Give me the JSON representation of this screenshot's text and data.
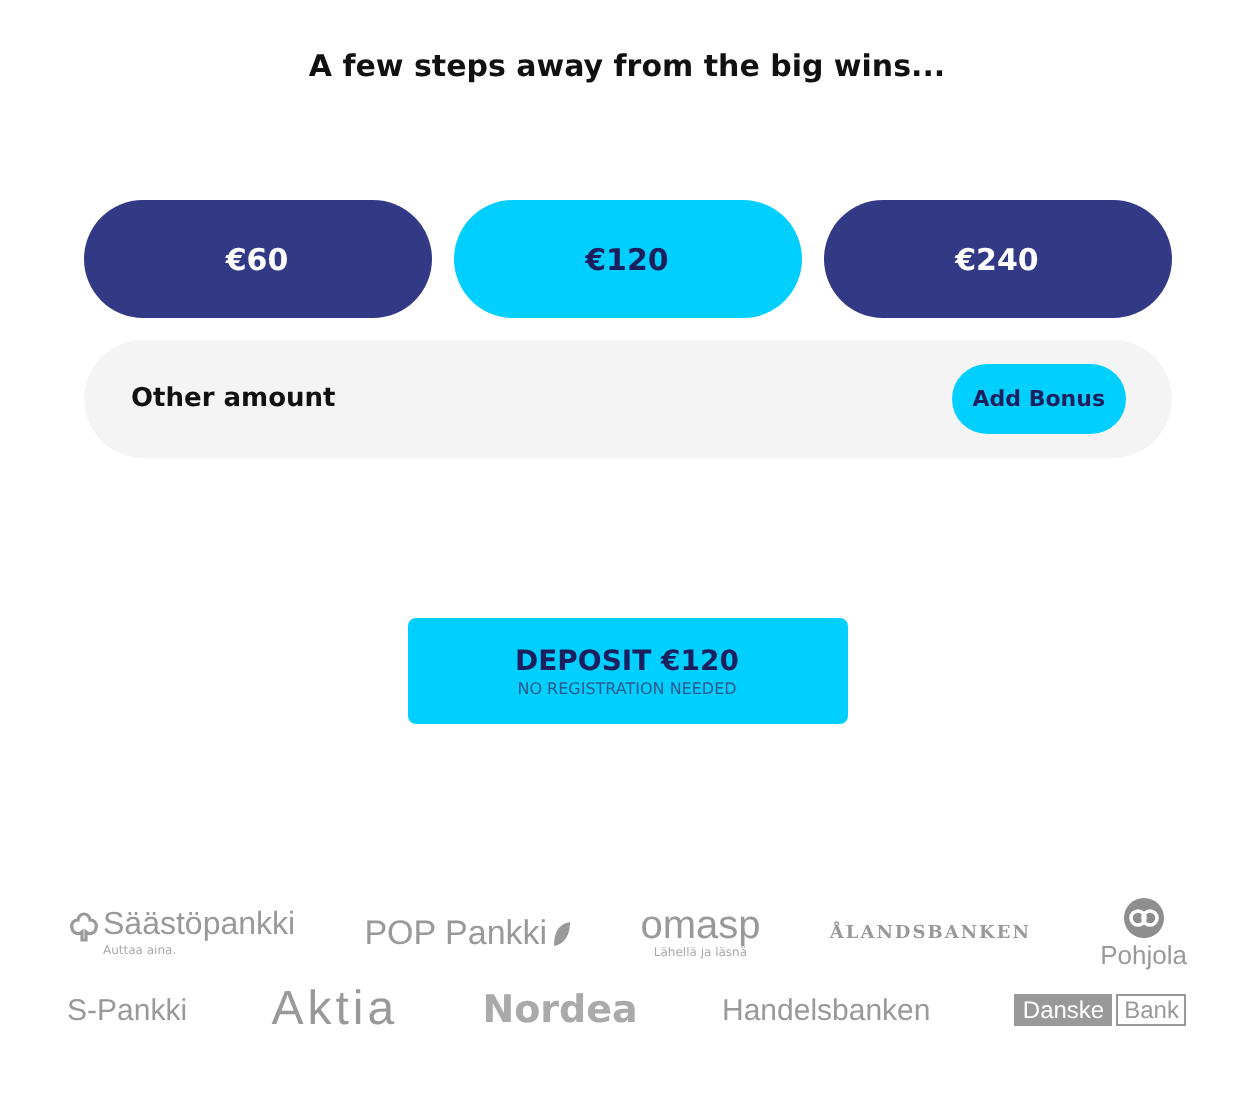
{
  "heading": "A few steps away from the big wins...",
  "amounts": [
    {
      "label": "€60",
      "selected": false
    },
    {
      "label": "€120",
      "selected": true
    },
    {
      "label": "€240",
      "selected": false
    }
  ],
  "other_amount": {
    "label": "Other amount",
    "button": "Add Bonus"
  },
  "deposit": {
    "label": "DEPOSIT €120",
    "sublabel": "NO REGISTRATION NEEDED"
  },
  "banks": [
    [
      {
        "kind": "tree",
        "name": "Säästöpankki",
        "tagline": "Auttaa aina."
      },
      {
        "kind": "leaf",
        "name": "POP Pankki"
      },
      {
        "kind": "loop",
        "name": "omasp",
        "tagline": "Lähellä ja läsnä"
      },
      {
        "kind": "caps",
        "name": "ÅLANDSBANKEN"
      },
      {
        "kind": "circle",
        "name": "Pohjola"
      }
    ],
    [
      {
        "kind": "plain",
        "name": "S-Pankki"
      },
      {
        "kind": "large",
        "name": "Aktia"
      },
      {
        "kind": "round",
        "name": "Nordea"
      },
      {
        "kind": "plain",
        "name": "Handelsbanken"
      },
      {
        "kind": "boxed",
        "name": "Danske",
        "tagline": "Bank"
      }
    ]
  ]
}
